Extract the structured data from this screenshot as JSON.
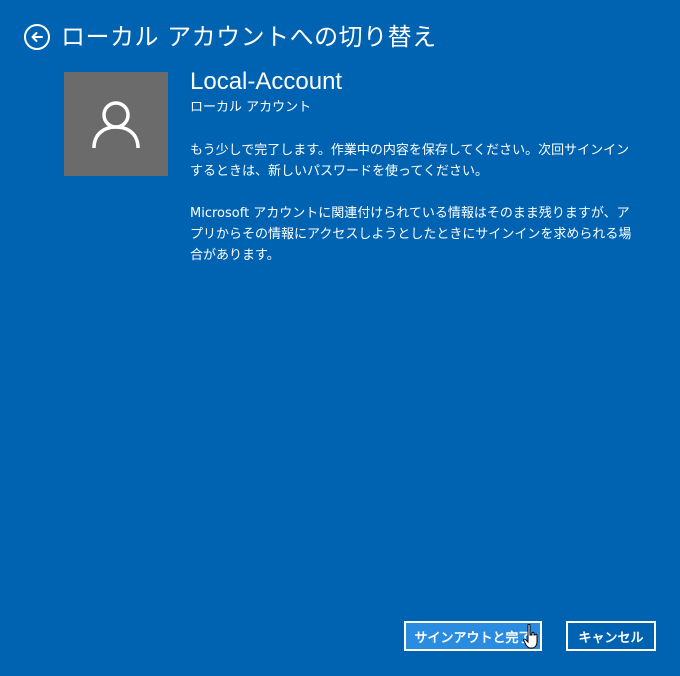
{
  "header": {
    "title": "ローカル アカウントへの切り替え",
    "back_icon": "arrow-left-circle-icon"
  },
  "account": {
    "avatar_icon": "person-icon",
    "name": "Local-Account",
    "type": "ローカル アカウント"
  },
  "messages": {
    "line1": "もう少しで完了します。作業中の内容を保存してください。次回サインインするときは、新しいパスワードを使ってください。",
    "line2": "Microsoft アカウントに関連付けられている情報はそのまま残りますが、アプリからその情報にアクセスしようとしたときにサインインを求められる場合があります。"
  },
  "buttons": {
    "signout_label": "サインアウトと完了",
    "cancel_label": "キャンセル"
  },
  "colors": {
    "background": "#0063b1",
    "primary_button": "#2a8ce0",
    "avatar_bg": "#6b6b6b"
  }
}
